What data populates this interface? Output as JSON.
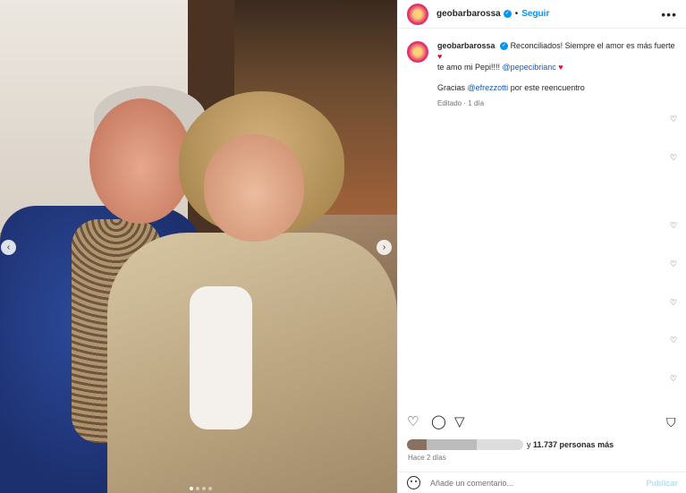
{
  "photo": {
    "nav_prev": "‹",
    "nav_next": "›",
    "carousel_count": 4,
    "carousel_active": 1
  },
  "header": {
    "username": "geobarbarossa",
    "separator": "•",
    "follow": "Seguir",
    "more": "•••"
  },
  "caption": {
    "username": "geobarbarossa",
    "text_part1": "Reconciliados! Siempre el amor es más fuerte",
    "text_part2": "te amo mi Pepi!!!!",
    "mention1": "@pepecibrianc",
    "line2_prefix": "Gracias",
    "mention2": "@efrezzotti",
    "line2_suffix": "por este reencuentro",
    "edited": "Editado",
    "dot": "·",
    "time": "1 día"
  },
  "icons": {
    "heart": "♥",
    "heart_outline": "♡",
    "comment": "◯",
    "share": "▽",
    "save": "⛉",
    "verified": "✓"
  },
  "likes": {
    "and": "y",
    "count_text": "11.737 personas más"
  },
  "posted": "Hace 2 días",
  "comment": {
    "placeholder": "Añade un comentario...",
    "publish": "Publicar"
  },
  "colors": {
    "accent": "#0095f6",
    "heart": "#e0102c",
    "mention": "#1a58b3"
  }
}
